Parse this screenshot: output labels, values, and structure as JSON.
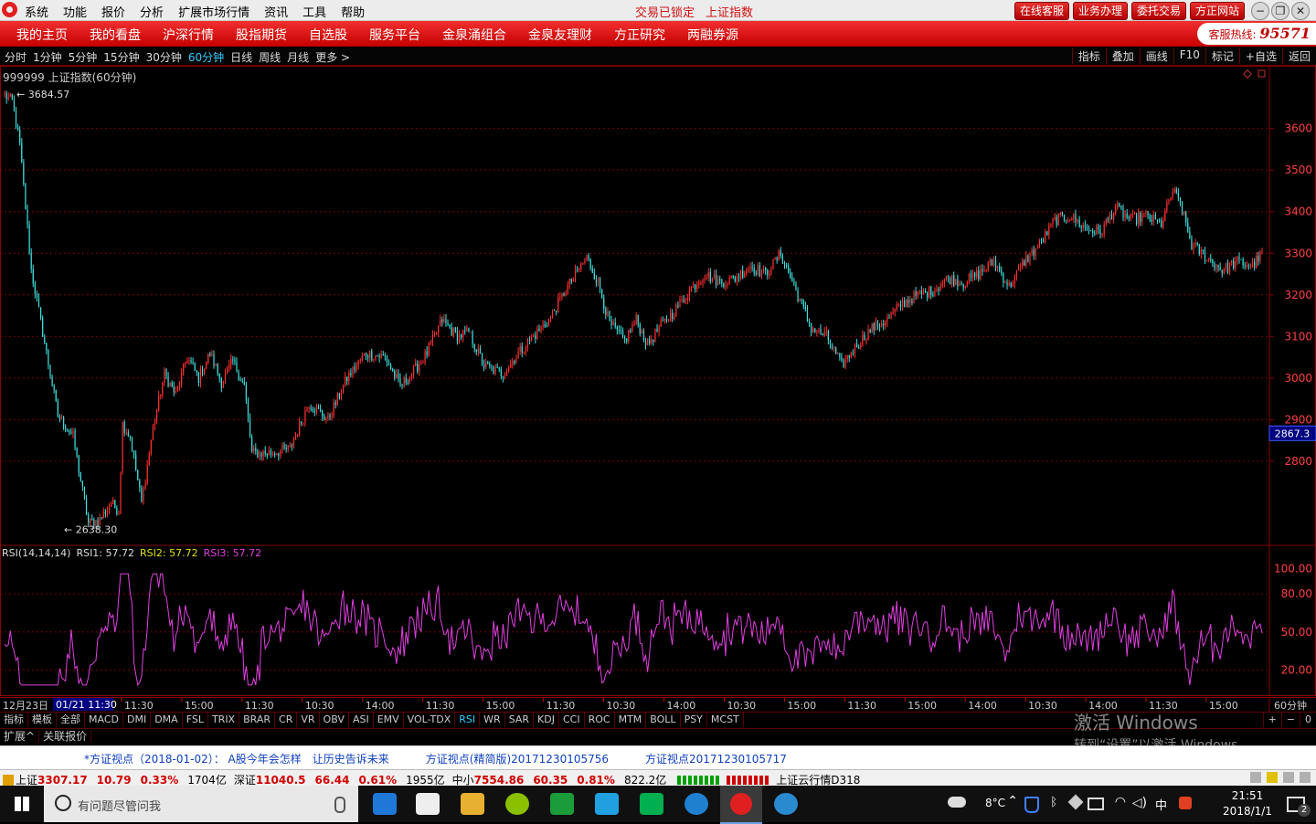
{
  "menubar": {
    "items": [
      "系统",
      "功能",
      "报价",
      "分析",
      "扩展市场行情",
      "资讯",
      "工具",
      "帮助"
    ],
    "center": [
      "交易已锁定",
      "上证指数"
    ],
    "right_buttons": [
      "在线客服",
      "业务办理",
      "委托交易",
      "方正网站"
    ],
    "window_controls": [
      "−",
      "❐",
      "✕"
    ]
  },
  "nav": {
    "items": [
      "我的主页",
      "我的看盘",
      "沪深行情",
      "股指期货",
      "自选股",
      "服务平台",
      "金泉涌组合",
      "金泉友理财",
      "方正研究",
      "两融券源"
    ],
    "hotline_label": "客服热线:",
    "hotline_number": "95571"
  },
  "periods": {
    "items": [
      "分时",
      "1分钟",
      "5分钟",
      "15分钟",
      "30分钟",
      "60分钟",
      "日线",
      "周线",
      "月线",
      "更多 >"
    ],
    "active": "60分钟",
    "tools": [
      "指标",
      "叠加",
      "画线",
      "F10",
      "标记",
      "+自选",
      "返回"
    ]
  },
  "chart": {
    "title": "999999 上证指数(60分钟)",
    "high_label": "3684.57",
    "low_label": "2638.30",
    "current_price_tag": "2867.3",
    "rsi_title": "RSI(14,14,14)",
    "rsi_values": [
      "RSI1: 57.72",
      "RSI2: 57.72",
      "RSI3: 57.72"
    ],
    "axis_period": "60分钟",
    "time_first": "12月23日",
    "time_highlight": "01/21 11:30",
    "colors": {
      "up": "#ff3030",
      "down": "#40e0e0",
      "rsi": "#e040e0",
      "grid": "#7a0000",
      "axis": "#8a0000"
    }
  },
  "chart_data": {
    "type": "candlestick",
    "y_ticks": [
      2800,
      2900,
      3000,
      3100,
      3200,
      3300,
      3400,
      3500,
      3600
    ],
    "ylim": [
      2600,
      3720
    ],
    "rsi_ticks": [
      20,
      50,
      80,
      100
    ],
    "rsi_tick_labels": [
      "20.00",
      "50.00",
      "80.00",
      "100.00"
    ],
    "rsi_ylim": [
      0,
      104
    ],
    "x_tick_labels": [
      "11:30",
      "15:00",
      "11:30",
      "10:30",
      "14:00",
      "11:30",
      "15:00",
      "11:30",
      "10:30",
      "14:00",
      "10:30",
      "15:00",
      "11:30",
      "15:00",
      "14:00",
      "10:30",
      "14:00",
      "11:30",
      "15:00"
    ],
    "anchors": [
      [
        0,
        3680
      ],
      [
        4,
        3665
      ],
      [
        8,
        3560
      ],
      [
        14,
        3260
      ],
      [
        20,
        3110
      ],
      [
        28,
        2910
      ],
      [
        36,
        2860
      ],
      [
        44,
        2650
      ],
      [
        50,
        2660
      ],
      [
        56,
        2700
      ],
      [
        60,
        2680
      ],
      [
        62,
        2890
      ],
      [
        66,
        2860
      ],
      [
        72,
        2700
      ],
      [
        78,
        2880
      ],
      [
        84,
        3010
      ],
      [
        90,
        2960
      ],
      [
        96,
        3050
      ],
      [
        102,
        3000
      ],
      [
        108,
        3060
      ],
      [
        114,
        2990
      ],
      [
        120,
        3040
      ],
      [
        126,
        2980
      ],
      [
        130,
        2820
      ],
      [
        140,
        2820
      ],
      [
        150,
        2830
      ],
      [
        160,
        2940
      ],
      [
        170,
        2900
      ],
      [
        180,
        3000
      ],
      [
        190,
        3060
      ],
      [
        200,
        3050
      ],
      [
        208,
        2980
      ],
      [
        214,
        3010
      ],
      [
        222,
        3060
      ],
      [
        230,
        3140
      ],
      [
        238,
        3100
      ],
      [
        244,
        3110
      ],
      [
        252,
        3030
      ],
      [
        262,
        3010
      ],
      [
        270,
        3060
      ],
      [
        278,
        3100
      ],
      [
        286,
        3140
      ],
      [
        296,
        3220
      ],
      [
        306,
        3290
      ],
      [
        312,
        3230
      ],
      [
        318,
        3130
      ],
      [
        326,
        3090
      ],
      [
        332,
        3140
      ],
      [
        338,
        3080
      ],
      [
        344,
        3120
      ],
      [
        352,
        3160
      ],
      [
        360,
        3210
      ],
      [
        368,
        3250
      ],
      [
        376,
        3230
      ],
      [
        384,
        3240
      ],
      [
        392,
        3270
      ],
      [
        400,
        3250
      ],
      [
        408,
        3300
      ],
      [
        416,
        3210
      ],
      [
        424,
        3120
      ],
      [
        432,
        3100
      ],
      [
        440,
        3030
      ],
      [
        448,
        3080
      ],
      [
        456,
        3120
      ],
      [
        464,
        3140
      ],
      [
        472,
        3180
      ],
      [
        480,
        3200
      ],
      [
        488,
        3210
      ],
      [
        496,
        3240
      ],
      [
        504,
        3230
      ],
      [
        512,
        3250
      ],
      [
        520,
        3280
      ],
      [
        528,
        3220
      ],
      [
        536,
        3280
      ],
      [
        544,
        3320
      ],
      [
        552,
        3380
      ],
      [
        560,
        3390
      ],
      [
        568,
        3360
      ],
      [
        576,
        3350
      ],
      [
        584,
        3410
      ],
      [
        592,
        3380
      ],
      [
        600,
        3390
      ],
      [
        608,
        3370
      ],
      [
        614,
        3450
      ],
      [
        618,
        3420
      ],
      [
        624,
        3320
      ],
      [
        632,
        3290
      ],
      [
        640,
        3260
      ],
      [
        648,
        3280
      ],
      [
        656,
        3270
      ],
      [
        661,
        3300
      ]
    ],
    "candle_count": 662,
    "last": 3307.17
  },
  "time_axis_label_color": "#ccc",
  "indicator_tabs": {
    "left": [
      "指标",
      "模板",
      "全部"
    ],
    "items": [
      "MACD",
      "DMI",
      "DMA",
      "FSL",
      "TRIX",
      "BRAR",
      "CR",
      "VR",
      "OBV",
      "ASI",
      "EMV",
      "VOL-TDX",
      "RSI",
      "WR",
      "SAR",
      "KDJ",
      "CCI",
      "ROC",
      "MTM",
      "BOLL",
      "PSY",
      "MCST"
    ],
    "active": "RSI",
    "zoom": [
      "+",
      "−",
      "0"
    ]
  },
  "ext_tabs": [
    "扩展^",
    "关联报价"
  ],
  "watermark": {
    "line1": "激活 Windows",
    "line2": "转到“设置”以激活 Windows。"
  },
  "news": {
    "items": [
      "*方证视点（2018-01-02）： A股今年会怎样　让历史告诉未来",
      "方证视点(精简版)20171230105756",
      "方证视点20171230105717"
    ]
  },
  "status": {
    "sh_label": "上证",
    "sh_value": "3307.17",
    "sh_change": "10.79",
    "sh_pct": "0.33%",
    "sh_amount": "1704亿",
    "sz_label": "深证",
    "sz_value": "11040.5",
    "sz_change": "66.44",
    "sz_pct": "0.61%",
    "sz_amount": "1955亿",
    "zx_label": "中小",
    "zx_value": "7554.86",
    "zx_change": "60.35",
    "zx_pct": "0.81%",
    "zx_amount": "822.2亿",
    "cloud": "上证云行情D318"
  },
  "taskbar": {
    "search_placeholder": "有问题尽管问我",
    "weather": "8°C",
    "ime": "中",
    "time": "21:51",
    "date": "2018/1/1",
    "notifications": "2"
  }
}
